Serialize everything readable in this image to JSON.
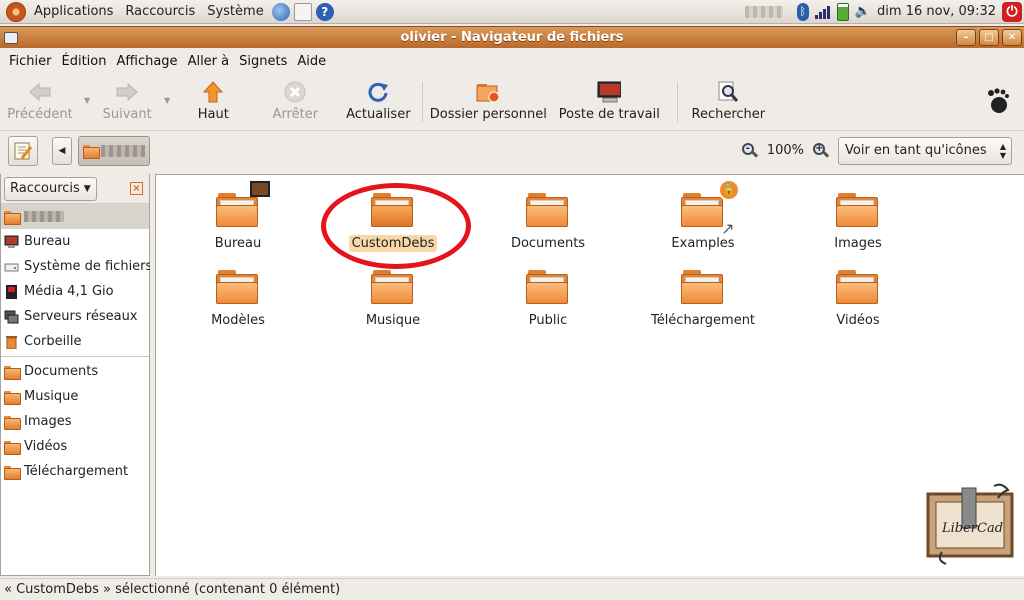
{
  "panel": {
    "applications": "Applications",
    "shortcuts": "Raccourcis",
    "system": "Système",
    "clock": "dim 16 nov, 09:32"
  },
  "window": {
    "title": "olivier - Navigateur de fichiers"
  },
  "menubar": {
    "items": [
      "Fichier",
      "Édition",
      "Affichage",
      "Aller à",
      "Signets",
      "Aide"
    ]
  },
  "toolbar": {
    "back": "Précédent",
    "forward": "Suivant",
    "up": "Haut",
    "stop": "Arrêter",
    "reload": "Actualiser",
    "home": "Dossier personnel",
    "computer": "Poste de travail",
    "search": "Rechercher"
  },
  "location": {
    "zoom": "100%",
    "view_mode": "Voir en tant qu'icônes"
  },
  "sidebar": {
    "header": "Raccourcis",
    "places": [
      {
        "label": "Bureau",
        "icon": "desktop-icon"
      },
      {
        "label": "Système de fichiers",
        "icon": "drive-icon"
      },
      {
        "label": "Média 4,1 Gio",
        "icon": "media-icon"
      },
      {
        "label": "Serveurs réseaux",
        "icon": "network-icon"
      },
      {
        "label": "Corbeille",
        "icon": "trash-icon"
      }
    ],
    "bookmarks": [
      "Documents",
      "Musique",
      "Images",
      "Vidéos",
      "Téléchargement"
    ]
  },
  "files": [
    {
      "label": "Bureau",
      "emblem": "film"
    },
    {
      "label": "CustomDebs",
      "selected": true
    },
    {
      "label": "Documents"
    },
    {
      "label": "Examples",
      "emblem": "lock-link"
    },
    {
      "label": "Images"
    },
    {
      "label": "Modèles"
    },
    {
      "label": "Musique"
    },
    {
      "label": "Public"
    },
    {
      "label": "Téléchargement"
    },
    {
      "label": "Vidéos"
    }
  ],
  "status": "« CustomDebs » sélectionné (contenant 0 élément)",
  "colors": {
    "title_bar": "#c77b38",
    "selection": "#f8d8a8",
    "annotation_circle": "#e3141c"
  }
}
